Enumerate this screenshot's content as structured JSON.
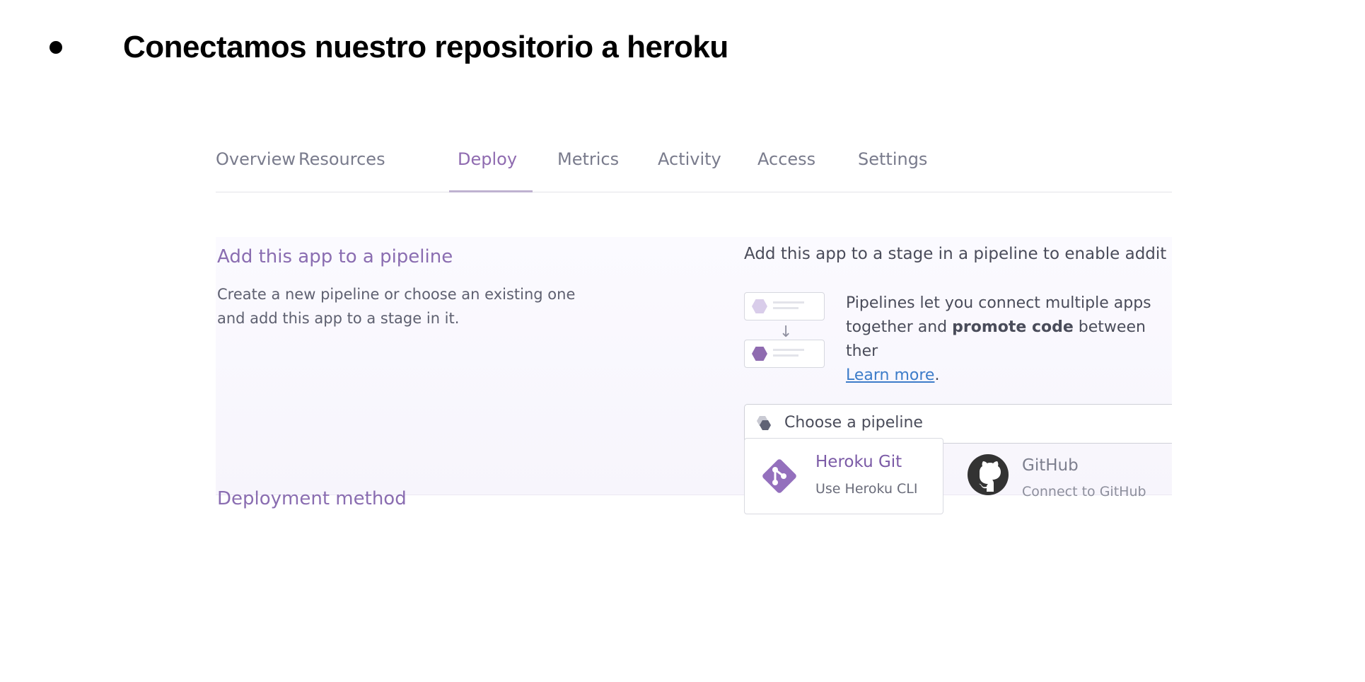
{
  "slide": {
    "title": "Conectamos nuestro repositorio a heroku"
  },
  "tabs": [
    "Overview",
    "Resources",
    "Deploy",
    "Metrics",
    "Activity",
    "Access",
    "Settings"
  ],
  "active_tab": "Deploy",
  "pipeline": {
    "title": "Add this app to a pipeline",
    "description": "Create a new pipeline or choose an existing one and add this app to a stage in it.",
    "heading": "Add this app to a stage in a pipeline to enable addit",
    "info_text_1": "Pipelines let you connect multiple apps together and",
    "info_bold": "promote code",
    "info_text_2": "between ther",
    "learn_more": "Learn more",
    "learn_more_suffix": ".",
    "choose_placeholder": "Choose a pipeline"
  },
  "deployment": {
    "title": "Deployment method",
    "methods": [
      {
        "name": "Heroku Git",
        "subtitle": "Use Heroku CLI",
        "icon": "heroku-git-icon"
      },
      {
        "name": "GitHub",
        "subtitle": "Connect to GitHub",
        "icon": "github-icon"
      }
    ]
  },
  "colors": {
    "accent": "#8f6bb0",
    "link": "#3d7cc9",
    "tab_text": "#797b8c"
  }
}
